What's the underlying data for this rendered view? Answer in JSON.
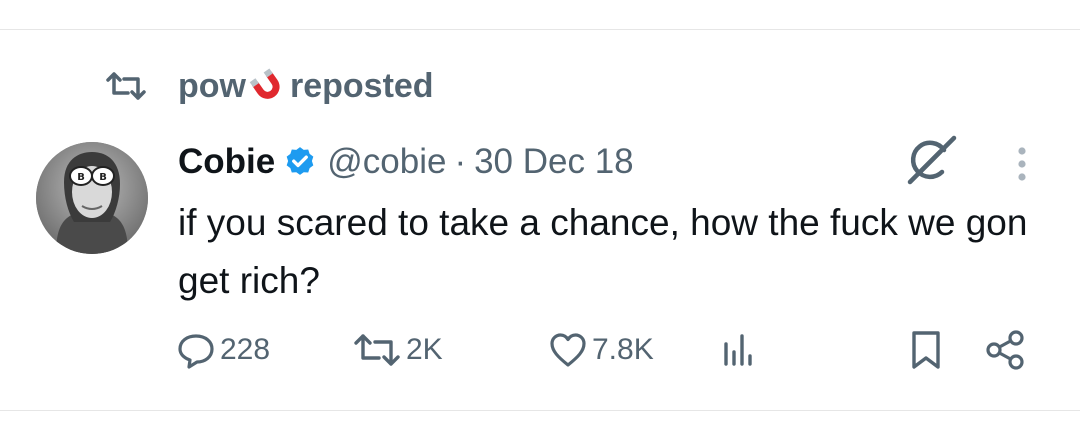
{
  "repost": {
    "icon": "repost-icon",
    "user_name": "pow",
    "emoji": "magnet",
    "label": "reposted"
  },
  "post": {
    "author_name": "Cobie",
    "verified": true,
    "handle": "@cobie",
    "separator": "·",
    "date": "30 Dec 18",
    "text": "if you scared to take a chance, how the fuck we gon get rich?"
  },
  "actions": {
    "replies": "228",
    "reposts": "2K",
    "likes": "7.8K"
  },
  "colors": {
    "text_primary": "#0f1419",
    "text_secondary": "#536471",
    "verified_blue": "#1d9bf0",
    "divider": "#e6e6e6"
  }
}
